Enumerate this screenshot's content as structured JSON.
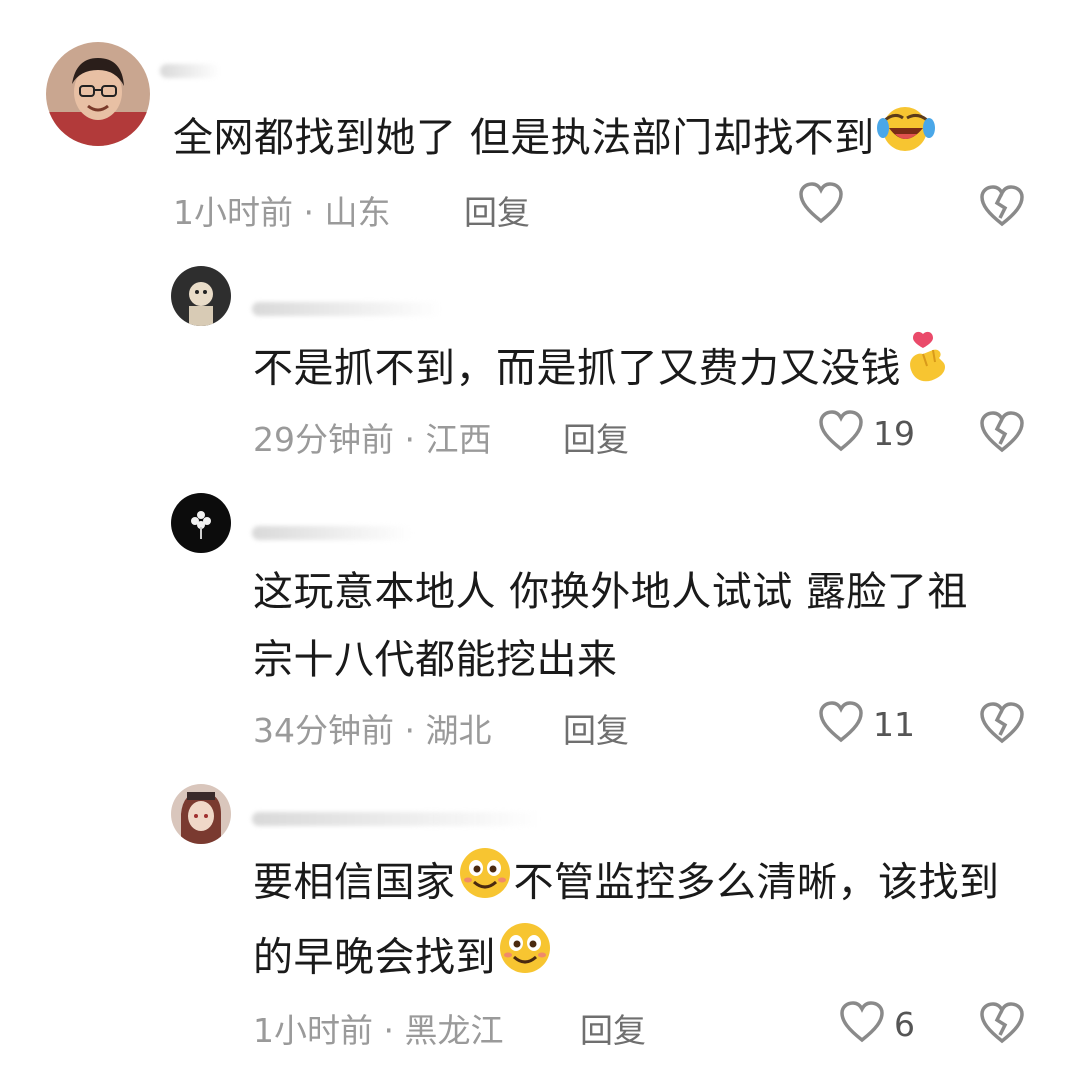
{
  "comments": [
    {
      "text_lines": [
        "全网都找到她了 但是执法部门却找不到"
      ],
      "emoji": "laugh-cry-emoji",
      "time": "1小时前",
      "location": "山东",
      "reply_label": "回复",
      "likes": ""
    },
    {
      "text_lines": [
        "不是抓不到，而是抓了又费力又没钱"
      ],
      "emoji": "finger-heart-emoji",
      "time": "29分钟前",
      "location": "江西",
      "reply_label": "回复",
      "likes": "19"
    },
    {
      "text_lines": [
        "这玩意本地人   你换外地人试试 露脸了祖",
        "宗十八代都能挖出来"
      ],
      "time": "34分钟前",
      "location": "湖北",
      "reply_label": "回复",
      "likes": "11"
    },
    {
      "text_line1_a": "要相信国家",
      "text_line1_b": "不管监控多么清晰，该找到",
      "text_line2": "的早晚会找到",
      "emoji": "smile-emoji",
      "time": "1小时前",
      "location": "黑龙江",
      "reply_label": "回复",
      "likes": "6"
    }
  ],
  "separator": "·",
  "colors": {
    "text": "#1a1a1a",
    "meta": "#9a9a9a",
    "reply": "#6f6f6f",
    "icon": "#8a8a8a",
    "emoji_yellow": "#f7c531"
  }
}
